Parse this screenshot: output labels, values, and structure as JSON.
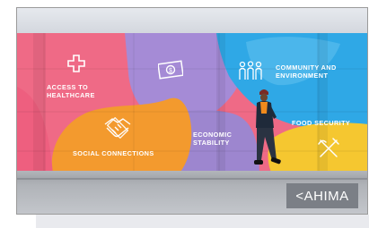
{
  "mural": {
    "access_label_line1": "ACCESS TO",
    "access_label_line2": "HEALTHCARE",
    "community_label_line1": "COMMUNITY AND",
    "community_label_line2": "ENVIRONMENT",
    "social_label": "SOCIAL CONNECTIONS",
    "economic_label_line1": "ECONOMIC",
    "economic_label_line2": "STABILITY",
    "food_label": "FOOD SECURITY"
  },
  "logo": {
    "text": "<AHIMA"
  },
  "icons": [
    "medical-cross-icon",
    "money-icon",
    "people-group-icon",
    "handshake-icon",
    "fork-knife-icon"
  ]
}
